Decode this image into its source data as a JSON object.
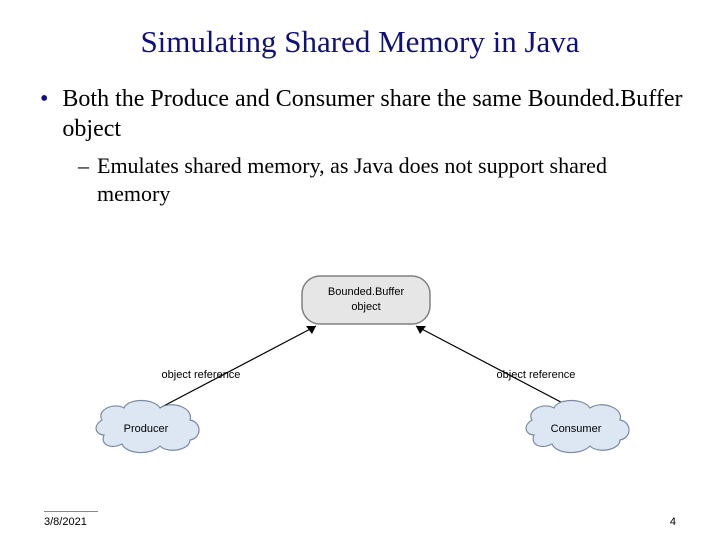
{
  "title": "Simulating Shared Memory in Java",
  "bullet": {
    "text": "Both the Produce and Consumer share the same Bounded.Buffer object"
  },
  "sub": {
    "text": "Emulates shared memory, as Java does not support shared memory"
  },
  "diagram": {
    "top_label": "Bounded.Buffer object",
    "arrow_left": "object reference",
    "arrow_right": "object reference",
    "left_box": "Producer",
    "right_box": "Consumer"
  },
  "footer": {
    "date": "3/8/2021",
    "page": "4"
  },
  "colors": {
    "title": "#10107a",
    "text": "#000000"
  }
}
